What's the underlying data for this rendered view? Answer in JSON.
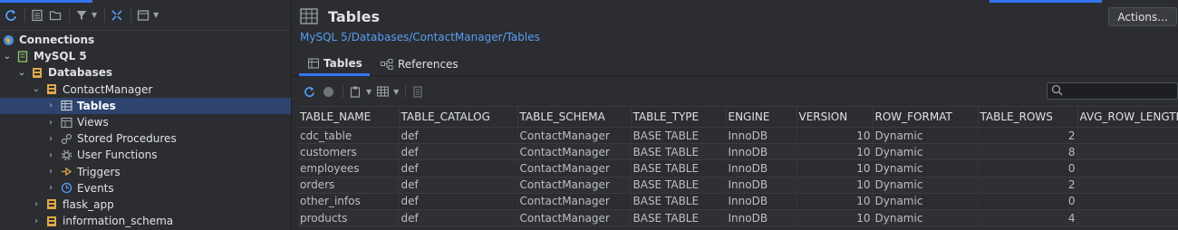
{
  "tree": {
    "connections": "Connections",
    "mysql": "MySQL 5",
    "databases": "Databases",
    "contact_manager": "ContactManager",
    "tables": "Tables",
    "views": "Views",
    "stored_procedures": "Stored Procedures",
    "user_functions": "User Functions",
    "triggers": "Triggers",
    "events": "Events",
    "flask_app": "flask_app",
    "information_schema": "information_schema"
  },
  "header": {
    "title": "Tables",
    "breadcrumb": "MySQL 5/Databases/ContactManager/Tables",
    "actions_label": "Actions..."
  },
  "tabs": [
    {
      "label": "Tables",
      "active": true
    },
    {
      "label": "References",
      "active": false
    }
  ],
  "table": {
    "columns": [
      "TABLE_NAME",
      "TABLE_CATALOG",
      "TABLE_SCHEMA",
      "TABLE_TYPE",
      "ENGINE",
      "VERSION",
      "ROW_FORMAT",
      "TABLE_ROWS",
      "AVG_ROW_LENGTH"
    ],
    "rows": [
      [
        "cdc_table",
        "def",
        "ContactManager",
        "BASE TABLE",
        "InnoDB",
        "10",
        "Dynamic",
        "2",
        ""
      ],
      [
        "customers",
        "def",
        "ContactManager",
        "BASE TABLE",
        "InnoDB",
        "10",
        "Dynamic",
        "8",
        ""
      ],
      [
        "employees",
        "def",
        "ContactManager",
        "BASE TABLE",
        "InnoDB",
        "10",
        "Dynamic",
        "0",
        ""
      ],
      [
        "orders",
        "def",
        "ContactManager",
        "BASE TABLE",
        "InnoDB",
        "10",
        "Dynamic",
        "2",
        ""
      ],
      [
        "other_infos",
        "def",
        "ContactManager",
        "BASE TABLE",
        "InnoDB",
        "10",
        "Dynamic",
        "0",
        ""
      ],
      [
        "products",
        "def",
        "ContactManager",
        "BASE TABLE",
        "InnoDB",
        "10",
        "Dynamic",
        "4",
        ""
      ]
    ]
  },
  "colors": {
    "accent": "#3574f0",
    "selected_row": "#2e436e",
    "breadcrumb_link": "#589df6",
    "folder_yellow": "#e0a84a"
  }
}
